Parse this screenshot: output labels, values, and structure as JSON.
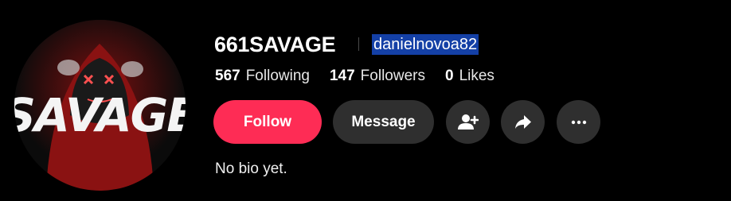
{
  "profile": {
    "display_name": "661SAVAGE",
    "handle": "danielnovoa82",
    "avatar_icon": "hooded-figure-savage-avatar",
    "avatar_text": "SAVAGE",
    "bio": "No bio yet."
  },
  "stats": [
    {
      "value": "567",
      "label": "Following"
    },
    {
      "value": "147",
      "label": "Followers"
    },
    {
      "value": "0",
      "label": "Likes"
    }
  ],
  "actions": {
    "follow_label": "Follow",
    "message_label": "Message",
    "add_friend_icon": "add-user-icon",
    "share_icon": "share-arrow-icon",
    "more_icon": "more-horizontal-icon"
  },
  "colors": {
    "follow": "#fe2c55",
    "secondary_button": "#2f2f2f",
    "handle_highlight": "#1440a6",
    "background": "#000000"
  }
}
